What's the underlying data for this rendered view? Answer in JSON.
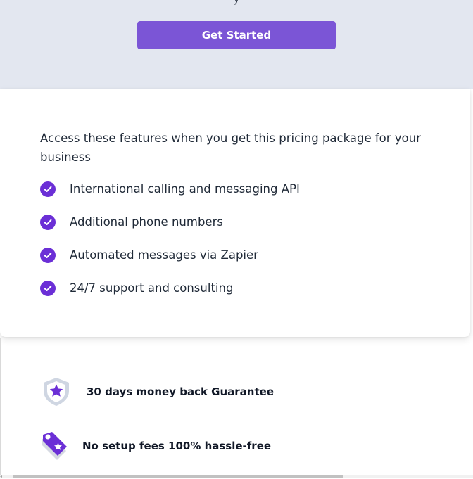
{
  "hero": {
    "partial_text": "y",
    "cta_label": "Get Started"
  },
  "features": {
    "intro": "Access these features when you get this pricing package for your business",
    "items": [
      {
        "label": "International calling and messaging API"
      },
      {
        "label": "Additional phone numbers"
      },
      {
        "label": "Automated messages via Zapier"
      },
      {
        "label": "24/7 support and consulting"
      }
    ]
  },
  "guarantees": [
    {
      "label": "30 days money back Guarantee",
      "icon": "shield-star-icon"
    },
    {
      "label": "No setup fees 100% hassle-free",
      "icon": "price-tag-icon"
    }
  ],
  "colors": {
    "accent": "#7b55d6",
    "check": "#6b2fd6",
    "band": "#e3e7f0"
  }
}
